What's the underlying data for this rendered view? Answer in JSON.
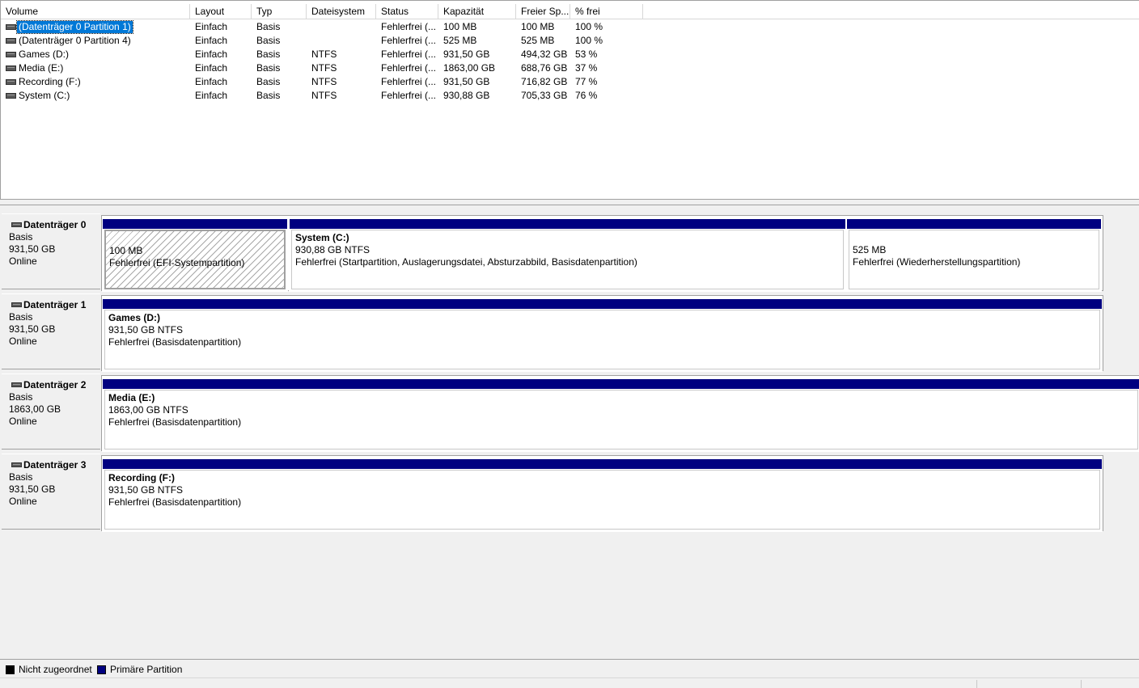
{
  "colors": {
    "primary_partition": "#000080",
    "unallocated": "#000000",
    "selection": "#0078d7"
  },
  "volume_list": {
    "columns": [
      "Volume",
      "Layout",
      "Typ",
      "Dateisystem",
      "Status",
      "Kapazität",
      "Freier Sp...",
      "% frei"
    ],
    "rows": [
      {
        "volume": "(Datenträger 0 Partition 1)",
        "layout": "Einfach",
        "typ": "Basis",
        "dateisystem": "",
        "status": "Fehlerfrei (...",
        "kapazitaet": "100 MB",
        "frei": "100 MB",
        "prozent": "100 %",
        "selected": true
      },
      {
        "volume": "(Datenträger 0 Partition 4)",
        "layout": "Einfach",
        "typ": "Basis",
        "dateisystem": "",
        "status": "Fehlerfrei (...",
        "kapazitaet": "525 MB",
        "frei": "525 MB",
        "prozent": "100 %"
      },
      {
        "volume": "Games (D:)",
        "layout": "Einfach",
        "typ": "Basis",
        "dateisystem": "NTFS",
        "status": "Fehlerfrei (...",
        "kapazitaet": "931,50 GB",
        "frei": "494,32 GB",
        "prozent": "53 %"
      },
      {
        "volume": "Media (E:)",
        "layout": "Einfach",
        "typ": "Basis",
        "dateisystem": "NTFS",
        "status": "Fehlerfrei (...",
        "kapazitaet": "1863,00 GB",
        "frei": "688,76 GB",
        "prozent": "37 %"
      },
      {
        "volume": "Recording (F:)",
        "layout": "Einfach",
        "typ": "Basis",
        "dateisystem": "NTFS",
        "status": "Fehlerfrei (...",
        "kapazitaet": "931,50 GB",
        "frei": "716,82 GB",
        "prozent": "77 %"
      },
      {
        "volume": "System (C:)",
        "layout": "Einfach",
        "typ": "Basis",
        "dateisystem": "NTFS",
        "status": "Fehlerfrei (...",
        "kapazitaet": "930,88 GB",
        "frei": "705,33 GB",
        "prozent": "76 %"
      }
    ]
  },
  "disks": [
    {
      "name": "Datenträger 0",
      "type": "Basis",
      "size": "931,50 GB",
      "state": "Online",
      "partitions": [
        {
          "name": "",
          "size_line": "100 MB",
          "status_line": "Fehlerfrei (EFI-Systempartition)",
          "hatched": true
        },
        {
          "name": "System  (C:)",
          "size_line": "930,88 GB NTFS",
          "status_line": "Fehlerfrei (Startpartition, Auslagerungsdatei, Absturzabbild, Basisdatenpartition)"
        },
        {
          "name": "",
          "size_line": "525 MB",
          "status_line": "Fehlerfrei (Wiederherstellungspartition)"
        }
      ]
    },
    {
      "name": "Datenträger 1",
      "type": "Basis",
      "size": "931,50 GB",
      "state": "Online",
      "partitions": [
        {
          "name": "Games  (D:)",
          "size_line": "931,50 GB NTFS",
          "status_line": "Fehlerfrei (Basisdatenpartition)"
        }
      ]
    },
    {
      "name": "Datenträger 2",
      "type": "Basis",
      "size": "1863,00 GB",
      "state": "Online",
      "partitions": [
        {
          "name": "Media  (E:)",
          "size_line": "1863,00 GB NTFS",
          "status_line": "Fehlerfrei (Basisdatenpartition)"
        }
      ]
    },
    {
      "name": "Datenträger 3",
      "type": "Basis",
      "size": "931,50 GB",
      "state": "Online",
      "partitions": [
        {
          "name": "Recording  (F:)",
          "size_line": "931,50 GB NTFS",
          "status_line": "Fehlerfrei (Basisdatenpartition)"
        }
      ]
    }
  ],
  "legend": {
    "unallocated_label": "Nicht zugeordnet",
    "primary_label": "Primäre Partition"
  }
}
